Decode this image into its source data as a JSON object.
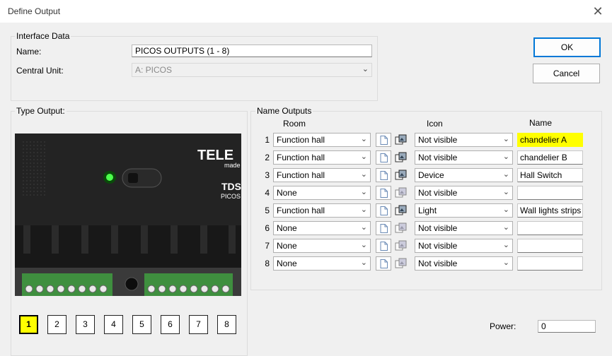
{
  "window": {
    "title": "Define Output",
    "close_glyph": "✕"
  },
  "interface": {
    "group_label": "Interface Data",
    "name_label": "Name:",
    "name_value": "PICOS OUTPUTS (1 - 8)",
    "central_unit_label": "Central Unit:",
    "central_unit_value": "A: PICOS"
  },
  "buttons": {
    "ok": "OK",
    "cancel": "Cancel"
  },
  "type_output": {
    "label": "Type Output:",
    "device_brand": "TELE",
    "device_made": "made",
    "device_model": "TDS",
    "device_sub": "PICOS",
    "output_buttons": [
      "1",
      "2",
      "3",
      "4",
      "5",
      "6",
      "7",
      "8"
    ],
    "selected": "1"
  },
  "name_outputs": {
    "label": "Name Outputs",
    "headers": {
      "room": "Room",
      "icon": "Icon",
      "name": "Name"
    },
    "highlight_color": "#ffff00",
    "rows": [
      {
        "num": "1",
        "room": "Function hall",
        "icon": "Not visible",
        "name": "chandelier A",
        "highlight": true
      },
      {
        "num": "2",
        "room": "Function hall",
        "icon": "Not visible",
        "name": "chandelier B"
      },
      {
        "num": "3",
        "room": "Function hall",
        "icon": "Device",
        "name": "Hall Switch"
      },
      {
        "num": "4",
        "room": "None",
        "icon": "Not visible",
        "name": ""
      },
      {
        "num": "5",
        "room": "Function hall",
        "icon": "Light",
        "name": "Wall lights strips"
      },
      {
        "num": "6",
        "room": "None",
        "icon": "Not visible",
        "name": ""
      },
      {
        "num": "7",
        "room": "None",
        "icon": "Not visible",
        "name": ""
      },
      {
        "num": "8",
        "room": "None",
        "icon": "Not visible",
        "name": ""
      }
    ]
  },
  "power": {
    "label": "Power:",
    "value": "0"
  },
  "icons": {
    "document": "document-icon",
    "room_picture": "room-picture-icon",
    "dropdown": "chevron-down-icon"
  }
}
